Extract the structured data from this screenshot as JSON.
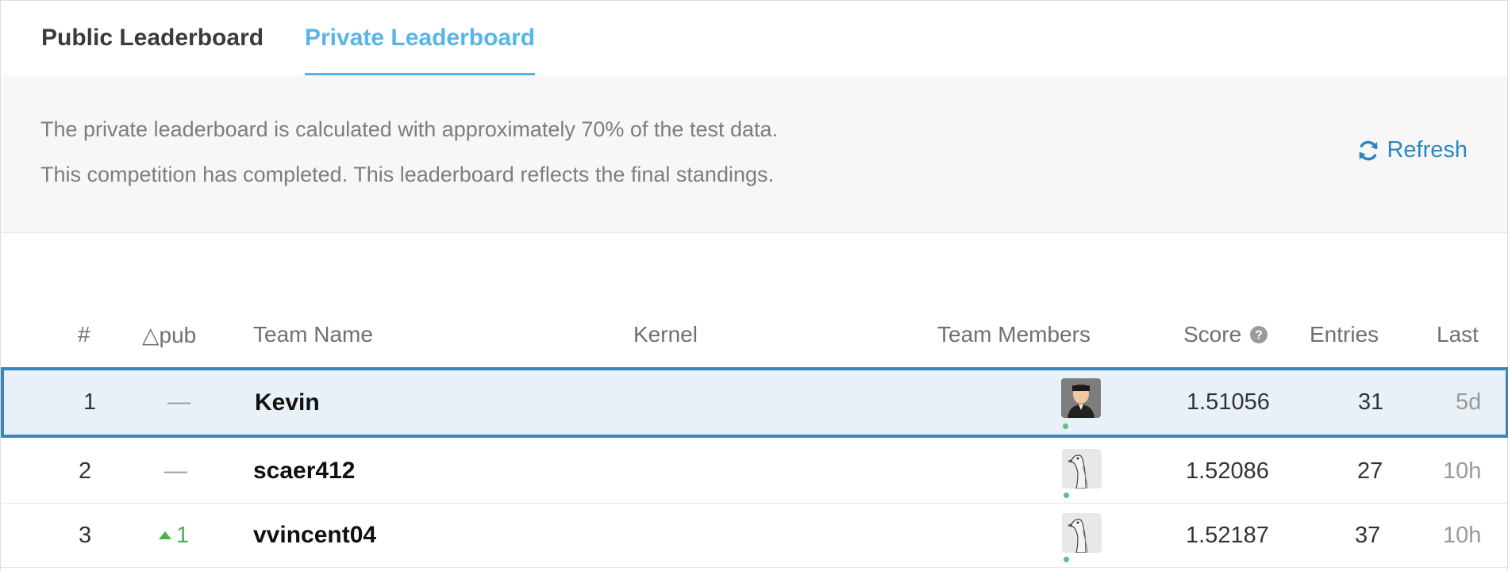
{
  "tabs": {
    "public_label": "Public Leaderboard",
    "private_label": "Private Leaderboard",
    "active": "private"
  },
  "banner": {
    "line1": "The private leaderboard is calculated with approximately 70% of the test data.",
    "line2": "This competition has completed. This leaderboard reflects the final standings.",
    "refresh_label": "Refresh",
    "refresh_icon": "refresh-icon"
  },
  "table": {
    "headers": {
      "rank": "#",
      "delta": "△pub",
      "team_name": "Team Name",
      "kernel": "Kernel",
      "team_members": "Team Members",
      "score": "Score",
      "entries": "Entries",
      "last": "Last"
    },
    "rows": [
      {
        "rank": "1",
        "delta": "—",
        "team": "Kevin",
        "score": "1.51056",
        "entries": "31",
        "last": "5d",
        "avatar": "person-avatar",
        "highlighted": true
      },
      {
        "rank": "2",
        "delta": "—",
        "team": "scaer412",
        "score": "1.52086",
        "entries": "27",
        "last": "10h",
        "avatar": "goose-avatar",
        "highlighted": false
      },
      {
        "rank": "3",
        "delta": "1",
        "delta_direction": "up",
        "team": "vvincent04",
        "score": "1.52187",
        "entries": "37",
        "last": "10h",
        "avatar": "goose-avatar",
        "highlighted": false
      }
    ]
  },
  "colors": {
    "accent": "#57b5ea",
    "link": "#2a87c4",
    "highlight_border": "#3c85b8",
    "highlight_bg": "#e9f1f8",
    "up_green": "#4caf50",
    "online_dot": "#5ec27f"
  }
}
